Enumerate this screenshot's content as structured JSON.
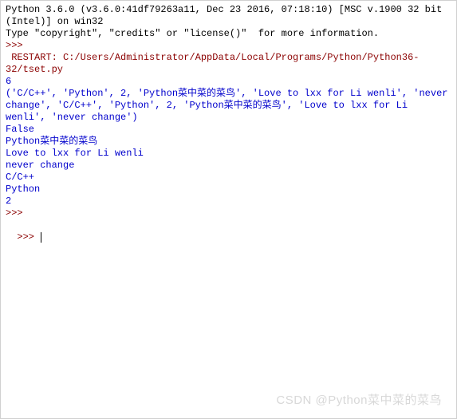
{
  "header": {
    "line1": "Python 3.6.0 (v3.6.0:41df79263a11, Dec 23 2016, 07:18:10) [MSC v.1900 32 bit (Intel)] on win32",
    "line2": "Type \"copyright\", \"credits\" or \"license()\"  for more information."
  },
  "prompts": {
    "p1": ">>> ",
    "p2": ">>> ",
    "p3": ">>> "
  },
  "restart": " RESTART: C:/Users/Administrator/AppData/Local/Programs/Python/Python36-32/tset.py ",
  "output": {
    "l1": "6",
    "l2": "('C/C++', 'Python', 2, 'Python菜中菜的菜鸟', 'Love to lxx for Li wenli', 'never change', 'C/C++', 'Python', 2, 'Python菜中菜的菜鸟', 'Love to lxx for Li wenli', 'never change')",
    "l3": "False",
    "l4": "Python菜中菜的菜鸟",
    "l5": "Love to lxx for Li wenli",
    "l6": "never change",
    "l7": "C/C++",
    "l8": "Python",
    "l9": "2"
  },
  "watermark": "CSDN @Python菜中菜的菜鸟"
}
